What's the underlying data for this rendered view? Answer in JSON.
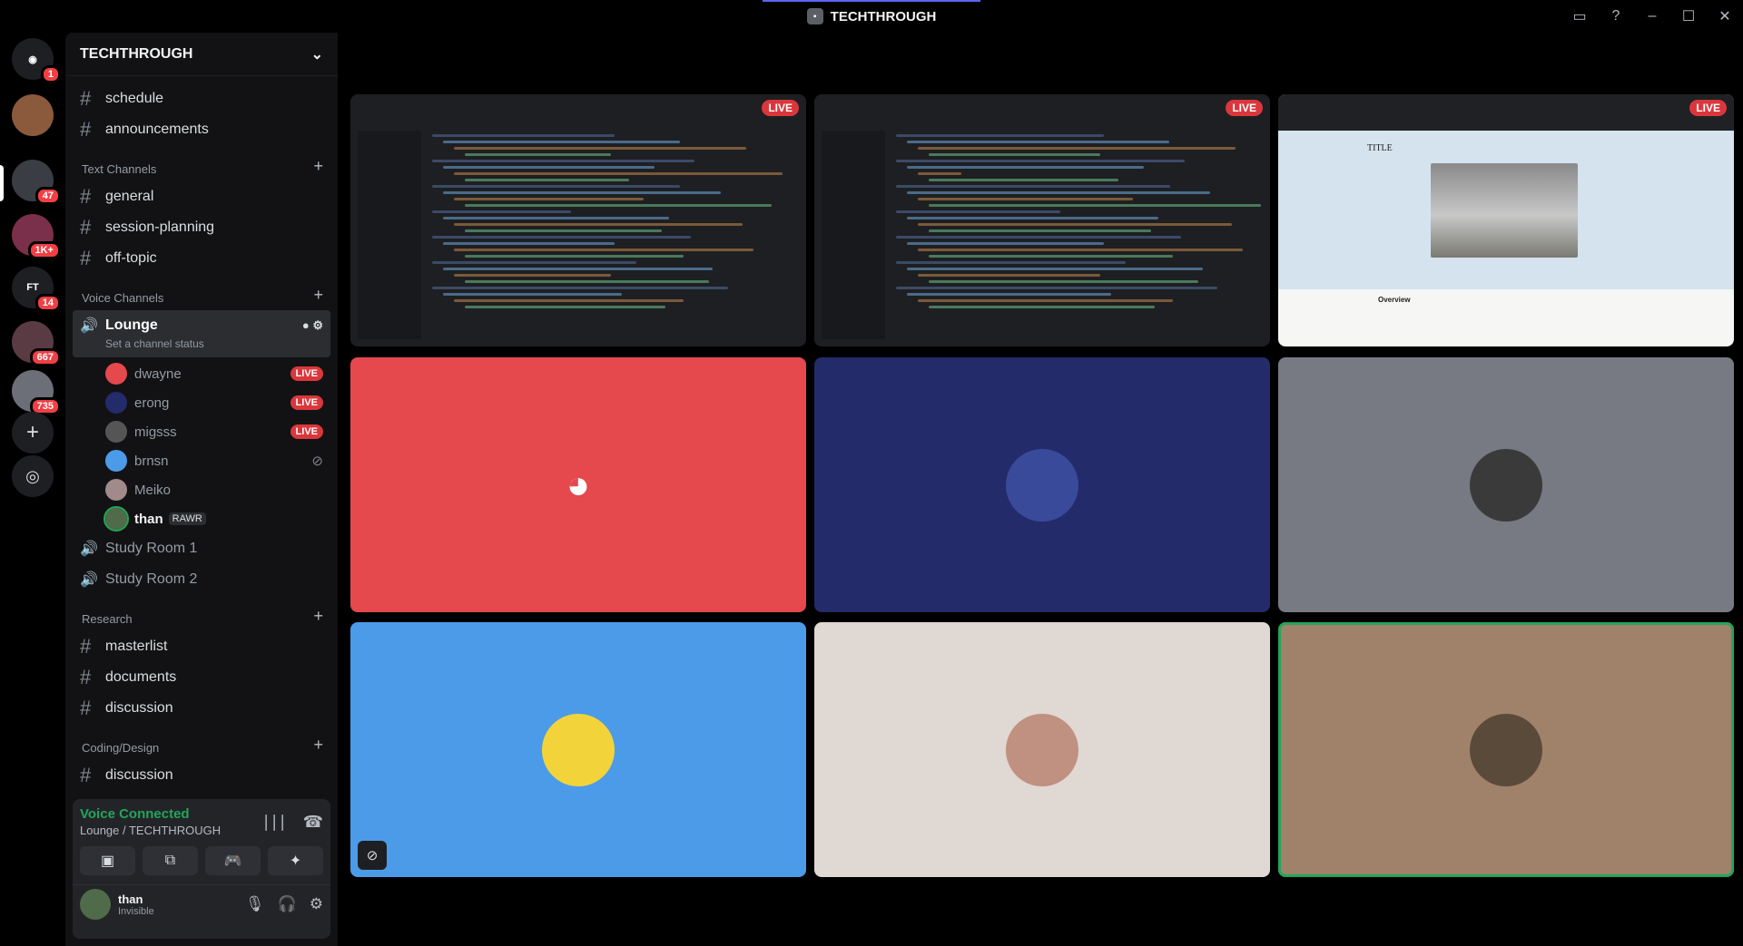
{
  "window": {
    "title": "TECHTHROUGH"
  },
  "guilds": [
    {
      "name": "direct-messages",
      "badge": "1"
    },
    {
      "name": "server-a",
      "badge": ""
    },
    {
      "name": "server-b",
      "badge": "47"
    },
    {
      "name": "server-c",
      "badge": "1K+"
    },
    {
      "name": "server-d",
      "label": "FT",
      "badge": "14"
    },
    {
      "name": "server-e",
      "badge": "667"
    },
    {
      "name": "server-f",
      "badge": "735"
    }
  ],
  "server": {
    "name": "TECHTHROUGH"
  },
  "channels": {
    "top": [
      "schedule",
      "announcements"
    ],
    "text_category": "Text Channels",
    "text": [
      "general",
      "session-planning",
      "off-topic"
    ],
    "voice_category": "Voice Channels",
    "active_voice": {
      "name": "Lounge",
      "status": "Set a channel status"
    },
    "voice_users": [
      {
        "name": "dwayne",
        "live": "LIVE"
      },
      {
        "name": "erong",
        "live": "LIVE"
      },
      {
        "name": "migsss",
        "live": "LIVE"
      },
      {
        "name": "brnsn",
        "live": ""
      },
      {
        "name": "Meiko",
        "live": ""
      },
      {
        "name": "than",
        "live": "",
        "tag": "RAWR"
      }
    ],
    "voice_rooms": [
      "Study Room 1",
      "Study Room 2"
    ],
    "research_category": "Research",
    "research": [
      "masterlist",
      "documents",
      "discussion"
    ],
    "coding_category": "Coding/Design",
    "coding": [
      "discussion"
    ]
  },
  "panel": {
    "status": "Voice Connected",
    "location": "Lounge / TECHTHROUGH",
    "user": "than",
    "presence": "Invisible"
  },
  "stage": {
    "live_label": "LIVE",
    "web_title": "TITLE",
    "web_section": "Overview"
  },
  "colors": {
    "accent": "#5865f2",
    "live": "#da373c",
    "connected": "#23a55a",
    "tile_red": "#e5484d",
    "tile_navy": "#232b6b",
    "tile_gray": "#777a82",
    "tile_blue": "#4c9be8",
    "tile_beige": "#e0d8d2",
    "tile_brown": "#a0826a"
  }
}
